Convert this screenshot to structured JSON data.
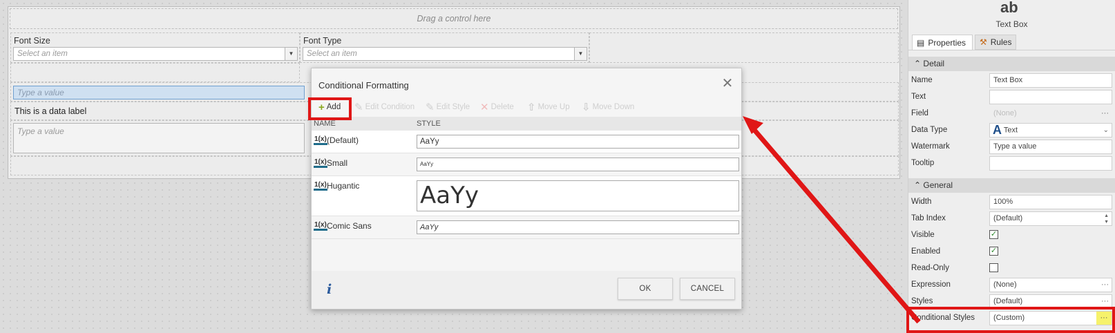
{
  "designer": {
    "drop_zone_text": "Drag a control here",
    "font_size_label": "Font Size",
    "font_size_placeholder": "Select an item",
    "font_type_label": "Font Type",
    "font_type_placeholder": "Select an item",
    "textbox_placeholder": "Type a value",
    "data_label_text": "This is a data label",
    "textarea_placeholder": "Type a value"
  },
  "dialog": {
    "title": "Conditional Formatting",
    "close_glyph": "✕",
    "toolbar": [
      {
        "label": "Add",
        "icon": "+",
        "icon_name": "add-icon",
        "enabled": true
      },
      {
        "label": "Edit Condition",
        "icon": "✎",
        "icon_name": "edit-condition-icon",
        "enabled": false
      },
      {
        "label": "Edit Style",
        "icon": "✎",
        "icon_name": "edit-style-icon",
        "enabled": false
      },
      {
        "label": "Delete",
        "icon": "✕",
        "icon_name": "delete-icon",
        "enabled": false
      },
      {
        "label": "Move Up",
        "icon": "⇧",
        "icon_name": "move-up-icon",
        "enabled": false
      },
      {
        "label": "Move Down",
        "icon": "⇩",
        "icon_name": "move-down-icon",
        "enabled": false
      }
    ],
    "columns": {
      "name": "NAME",
      "style": "STYLE"
    },
    "rows": [
      {
        "name": "(Default)",
        "style_preview": "AaYy",
        "preview_size": "normal"
      },
      {
        "name": "Small",
        "style_preview": "AaYy",
        "preview_size": "small"
      },
      {
        "name": "Hugantic",
        "style_preview": "AaYy",
        "preview_size": "huge"
      },
      {
        "name": "Comic Sans",
        "style_preview": "AaYy",
        "preview_size": "comic"
      }
    ],
    "fx_icon_text": "1(x)",
    "info_glyph": "i",
    "ok_label": "OK",
    "cancel_label": "CANCEL"
  },
  "panel": {
    "control_icon_text": "ab",
    "control_name": "Text Box",
    "tabs": [
      {
        "label": "Properties",
        "icon_name": "properties-icon"
      },
      {
        "label": "Rules",
        "icon_name": "rules-icon"
      }
    ],
    "detail_section": "Detail",
    "general_section": "General",
    "detail_props": [
      {
        "label": "Name",
        "value": "Text Box"
      },
      {
        "label": "Text",
        "value": ""
      },
      {
        "label": "Field",
        "value": "(None)",
        "disabled": true,
        "ellipsis": "···"
      },
      {
        "label": "Data Type",
        "value": "Text"
      },
      {
        "label": "Watermark",
        "value": "Type a value"
      },
      {
        "label": "Tooltip",
        "value": ""
      }
    ],
    "general_props": [
      {
        "label": "Width",
        "value": "100%"
      },
      {
        "label": "Tab Index",
        "value": "(Default)"
      },
      {
        "label": "Visible",
        "checked": true
      },
      {
        "label": "Enabled",
        "checked": true
      },
      {
        "label": "Read-Only",
        "checked": false
      },
      {
        "label": "Expression",
        "value": "(None)",
        "ellipsis": "···"
      },
      {
        "label": "Styles",
        "value": "(Default)",
        "ellipsis": "···"
      },
      {
        "label": "Conditional Styles",
        "value": "(Custom)",
        "ellipsis": "···"
      }
    ]
  },
  "colors": {
    "annotation_red": "#e01616",
    "highlight_yellow": "#f6f26b",
    "selection_blue": "#cfe0f1"
  }
}
